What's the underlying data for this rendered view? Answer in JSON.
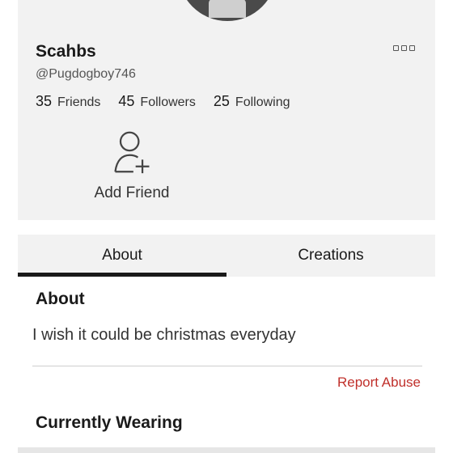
{
  "profile": {
    "display_name": "Scahbs",
    "username": "@Pugdogboy746",
    "stats": [
      {
        "count": "35",
        "label": "Friends"
      },
      {
        "count": "45",
        "label": "Followers"
      },
      {
        "count": "25",
        "label": "Following"
      }
    ],
    "add_friend_label": "Add Friend",
    "more_icon": "more-options-icon"
  },
  "tabs": [
    {
      "label": "About",
      "active": true
    },
    {
      "label": "Creations",
      "active": false
    }
  ],
  "about": {
    "heading": "About",
    "text": "I wish it could be christmas everyday",
    "report_label": "Report Abuse"
  },
  "wearing": {
    "heading": "Currently Wearing"
  },
  "colors": {
    "card_bg": "#f2f2f2",
    "report": "#c0302b",
    "tab_indicator": "#1a1a1a"
  }
}
